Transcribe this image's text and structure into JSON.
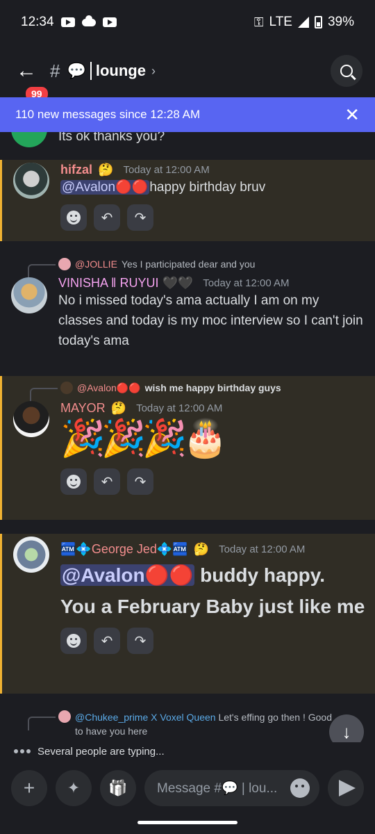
{
  "status_bar": {
    "time": "12:34",
    "network": "LTE",
    "battery": "39%"
  },
  "header": {
    "badge": "99",
    "hash": "#",
    "channel_emoji": "💬",
    "channel_name": "lounge",
    "chevron": "›"
  },
  "banner": {
    "text": "110 new messages since 12:28 AM",
    "close": "✕"
  },
  "partial_message": {
    "text": "Its ok thanks you?"
  },
  "messages": [
    {
      "author": "hifzal",
      "author_color": "#f28d8d",
      "author_emoji": "🤔",
      "timestamp": "Today at 12:00 AM",
      "mention": "@Avalon🔴🔴",
      "text": "happy birthday bruv"
    },
    {
      "reply_name": "@JOLLIE",
      "reply_text": "Yes I participated dear and you",
      "author": "VINISHA ‖ RUYUI 🖤🖤",
      "author_color": "#f5a3f0",
      "timestamp": "Today at 12:00 AM",
      "text": "No i missed today's ama actually I am on my classes and today is my moc interview so I can't join today's ama"
    },
    {
      "reply_name": "@Avalon🔴🔴",
      "reply_text": "wish me happy birthday guys",
      "author": "MAYOR",
      "author_color": "#f28d8d",
      "author_emoji": "🤔",
      "timestamp": "Today at 12:00 AM",
      "text": "🎉🎉🎉🎂"
    },
    {
      "author": "🏧💠George Jed💠🏧",
      "author_color": "#f28d8d",
      "author_emoji": "🤔",
      "timestamp": "Today at 12:00 AM",
      "mention": "@Avalon🔴🔴",
      "text": " buddy happy. You a February Baby just like me"
    },
    {
      "reply_name": "@Chukee_prime X Voxel Queen",
      "reply_text": "Let's effing go then ! Good to have you here"
    }
  ],
  "actions": {
    "react": "",
    "reply": "↶",
    "forward": "↷"
  },
  "typing": {
    "text": "Several people are typing..."
  },
  "composer": {
    "placeholder": "Message #💬 | lou...",
    "plus": "+",
    "gift": "🎁"
  },
  "colors": {
    "accent": "#5865f2",
    "highlight_bar": "#f0b232",
    "background": "#1c1d22"
  }
}
